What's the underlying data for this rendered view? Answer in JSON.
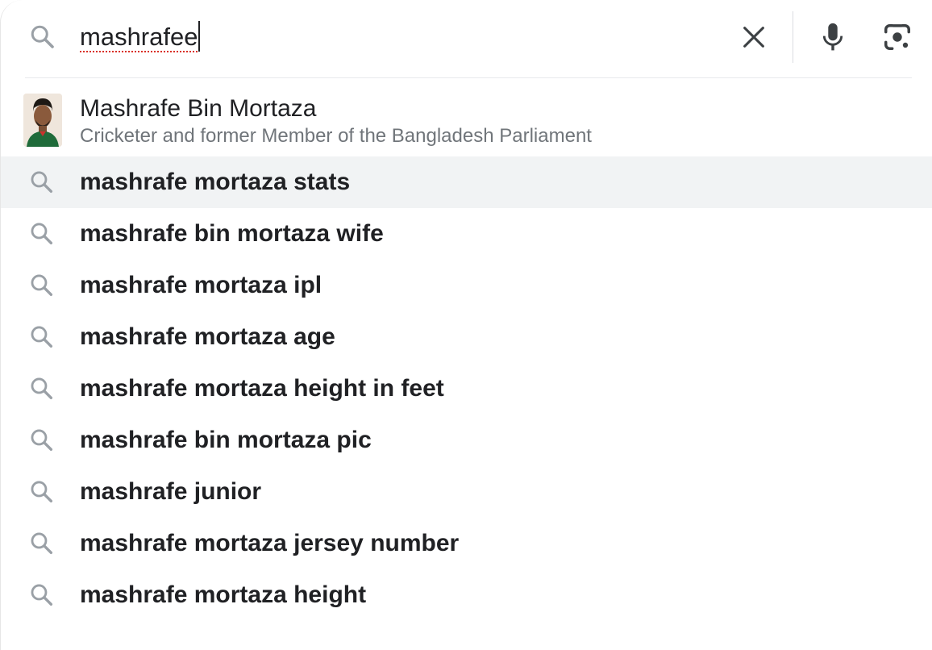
{
  "search": {
    "query": "mashrafee"
  },
  "icons": {
    "search": "search-icon",
    "clear": "close-icon",
    "voice": "microphone-icon",
    "lens": "camera-lens-icon"
  },
  "colors": {
    "text": "#202124",
    "secondary_text": "#70757a",
    "icon": "#9aa0a6",
    "highlight_row": "#f1f3f4",
    "spellcheck_underline": "#d93025"
  },
  "entity": {
    "title": "Mashrafe Bin Mortaza",
    "subtitle": "Cricketer and former Member of the Bangladesh Parliament"
  },
  "suggestions": [
    {
      "text": "mashrafe mortaza stats"
    },
    {
      "text": "mashrafe bin mortaza wife"
    },
    {
      "text": "mashrafe mortaza ipl"
    },
    {
      "text": "mashrafe mortaza age"
    },
    {
      "text": "mashrafe mortaza height in feet"
    },
    {
      "text": "mashrafe bin mortaza pic"
    },
    {
      "text": "mashrafe junior"
    },
    {
      "text": "mashrafe mortaza jersey number"
    },
    {
      "text": "mashrafe mortaza height"
    }
  ]
}
